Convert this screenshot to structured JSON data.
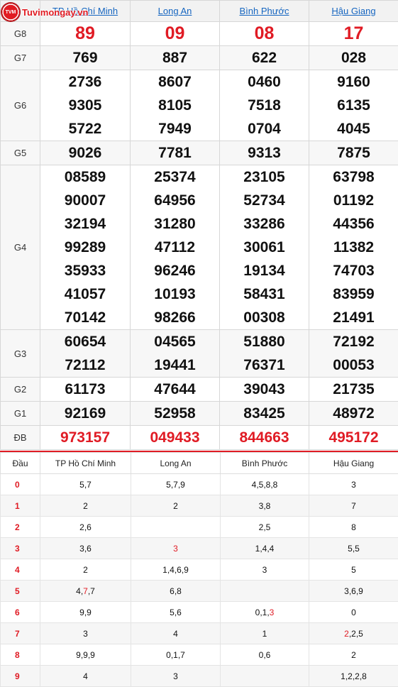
{
  "logo": {
    "text": "Tuvimongay.vn",
    "badge": "TVM"
  },
  "provinces": [
    "TP Hồ Chí Minh",
    "Long An",
    "Bình Phước",
    "Hậu Giang"
  ],
  "prizes": [
    {
      "label": "G8",
      "rows": [
        [
          "89",
          "09",
          "08",
          "17"
        ]
      ],
      "highlight": true
    },
    {
      "label": "G7",
      "rows": [
        [
          "769",
          "887",
          "622",
          "028"
        ]
      ]
    },
    {
      "label": "G6",
      "rows": [
        [
          "2736",
          "8607",
          "0460",
          "9160"
        ],
        [
          "9305",
          "8105",
          "7518",
          "6135"
        ],
        [
          "5722",
          "7949",
          "0704",
          "4045"
        ]
      ]
    },
    {
      "label": "G5",
      "rows": [
        [
          "9026",
          "7781",
          "9313",
          "7875"
        ]
      ]
    },
    {
      "label": "G4",
      "rows": [
        [
          "08589",
          "25374",
          "23105",
          "63798"
        ],
        [
          "90007",
          "64956",
          "52734",
          "01192"
        ],
        [
          "32194",
          "31280",
          "33286",
          "44356"
        ],
        [
          "99289",
          "47112",
          "30061",
          "11382"
        ],
        [
          "35933",
          "96246",
          "19134",
          "74703"
        ],
        [
          "41057",
          "10193",
          "58431",
          "83959"
        ],
        [
          "70142",
          "98266",
          "00308",
          "21491"
        ]
      ]
    },
    {
      "label": "G3",
      "rows": [
        [
          "60654",
          "04565",
          "51880",
          "72192"
        ],
        [
          "72112",
          "19441",
          "76371",
          "00053"
        ]
      ]
    },
    {
      "label": "G2",
      "rows": [
        [
          "61173",
          "47644",
          "39043",
          "21735"
        ]
      ]
    },
    {
      "label": "G1",
      "rows": [
        [
          "92169",
          "52958",
          "83425",
          "48972"
        ]
      ]
    },
    {
      "label": "ĐB",
      "rows": [
        [
          "973157",
          "049433",
          "844663",
          "495172"
        ]
      ],
      "special": true
    }
  ],
  "loto": {
    "header": [
      "Đầu",
      "TP Hồ Chí Minh",
      "Long An",
      "Bình Phước",
      "Hậu Giang"
    ],
    "rows": [
      {
        "dau": "0",
        "cells": [
          [
            "5,7"
          ],
          [
            "5,7,9"
          ],
          [
            "4,5,8,8"
          ],
          [
            "3"
          ]
        ]
      },
      {
        "dau": "1",
        "cells": [
          [
            "2"
          ],
          [
            "2"
          ],
          [
            "3,8"
          ],
          [
            "7"
          ]
        ]
      },
      {
        "dau": "2",
        "cells": [
          [
            "2,6"
          ],
          [
            ""
          ],
          [
            "2,5"
          ],
          [
            "8"
          ]
        ]
      },
      {
        "dau": "3",
        "cells": [
          [
            "3,6"
          ],
          [
            "",
            "3"
          ],
          [
            "1,4,4"
          ],
          [
            "5,5"
          ]
        ]
      },
      {
        "dau": "4",
        "cells": [
          [
            "2"
          ],
          [
            "1,4,6,9"
          ],
          [
            "3"
          ],
          [
            "5"
          ]
        ]
      },
      {
        "dau": "5",
        "cells": [
          [
            "4,",
            "7",
            ",7"
          ],
          [
            "6,8"
          ],
          [
            ""
          ],
          [
            "3,6,9"
          ]
        ]
      },
      {
        "dau": "6",
        "cells": [
          [
            "9,9"
          ],
          [
            "5,6"
          ],
          [
            "0,1,",
            "3"
          ],
          [
            "0"
          ]
        ]
      },
      {
        "dau": "7",
        "cells": [
          [
            "3"
          ],
          [
            "4"
          ],
          [
            "1"
          ],
          [
            "",
            "2",
            ",2,5"
          ]
        ]
      },
      {
        "dau": "8",
        "cells": [
          [
            "9,9,9"
          ],
          [
            "0,1,7"
          ],
          [
            "0,6"
          ],
          [
            "2"
          ]
        ]
      },
      {
        "dau": "9",
        "cells": [
          [
            "4"
          ],
          [
            "3"
          ],
          [
            ""
          ],
          [
            "1,2,2,8"
          ]
        ]
      }
    ]
  },
  "colors": {
    "accent_red": "#e01b24",
    "link_blue": "#1565c0"
  }
}
